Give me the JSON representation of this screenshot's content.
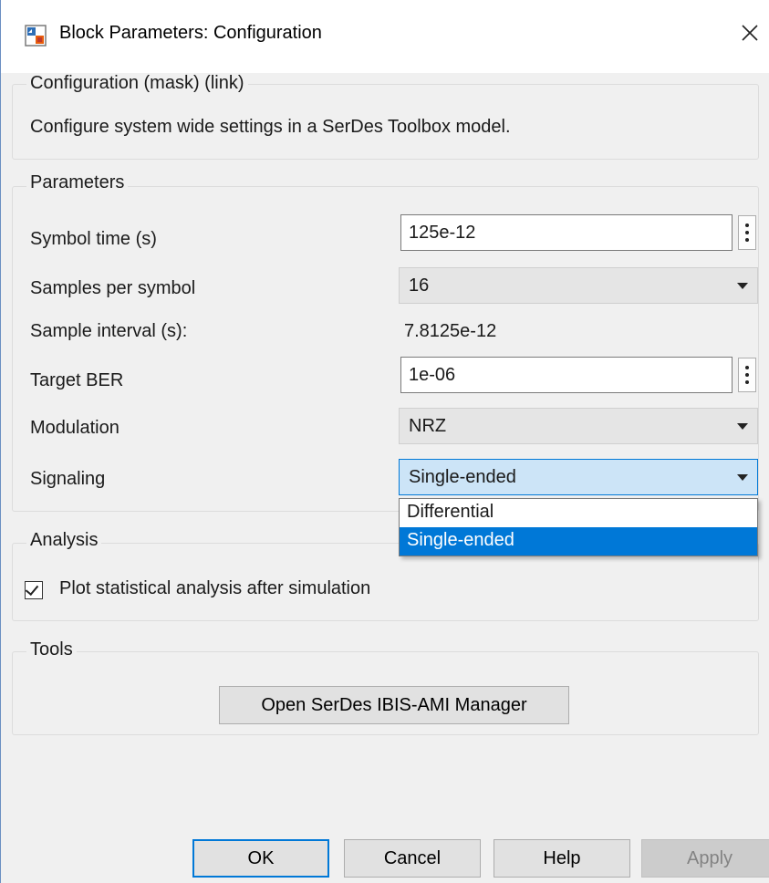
{
  "window": {
    "title": "Block Parameters: Configuration",
    "icons": {
      "app": "simulink-block-icon",
      "close": "close-icon"
    }
  },
  "description": {
    "group_title": "Configuration (mask) (link)",
    "text": "Configure system wide settings in a SerDes Toolbox model."
  },
  "parameters": {
    "group_title": "Parameters",
    "symbol_time": {
      "label": "Symbol time (s)",
      "value": "125e-12"
    },
    "samples_per_symbol": {
      "label": "Samples per symbol",
      "value": "16"
    },
    "sample_interval": {
      "label": "Sample interval (s):",
      "value": "7.8125e-12"
    },
    "target_ber": {
      "label": "Target BER",
      "value": "1e-06"
    },
    "modulation": {
      "label": "Modulation",
      "value": "NRZ"
    },
    "signaling": {
      "label": "Signaling",
      "value": "Single-ended",
      "options": [
        "Differential",
        "Single-ended"
      ],
      "selected_option": "Single-ended"
    }
  },
  "analysis": {
    "group_title": "Analysis",
    "plot_checkbox": {
      "label": "Plot statistical analysis after simulation",
      "checked": true
    }
  },
  "tools": {
    "group_title": "Tools",
    "manager_button": "Open SerDes IBIS-AMI Manager"
  },
  "buttons": {
    "ok": "OK",
    "cancel": "Cancel",
    "help": "Help",
    "apply": "Apply"
  },
  "colors": {
    "accent": "#0078d7",
    "selected_option_bg": "#0078d7",
    "active_combo_bg": "#cce4f7",
    "disabled_text": "#838383"
  }
}
